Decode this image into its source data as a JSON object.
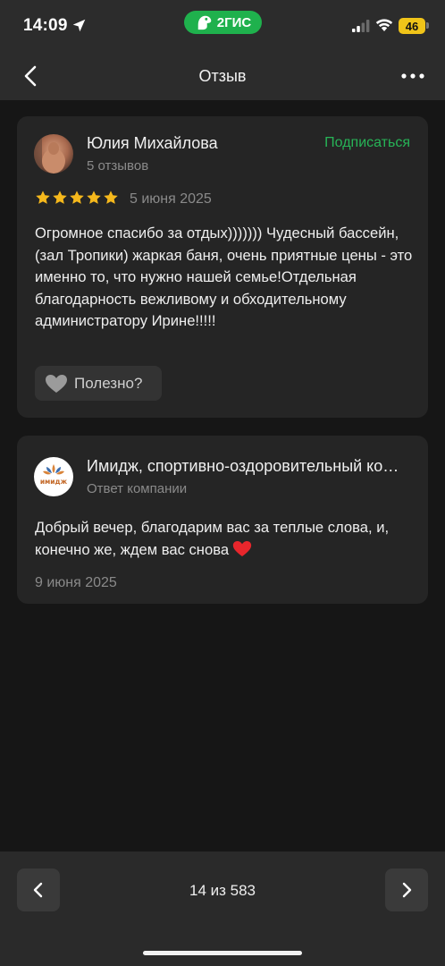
{
  "status_bar": {
    "time": "14:09",
    "app_badge": "2ГИС",
    "battery": "46",
    "colors": {
      "app_badge": "#1fb14d",
      "battery": "#f0c419"
    }
  },
  "nav": {
    "title": "Отзыв",
    "back_icon": "chevron-left-icon",
    "more_icon": "more-horizontal-icon"
  },
  "review": {
    "author": "Юлия Михайлова",
    "author_reviews": "5 отзывов",
    "subscribe_label": "Подписаться",
    "rating": 5,
    "rating_max": 5,
    "date": "5 июня 2025",
    "text": "Огромное спасибо за отдых))))))) Чудесный бассейн,(зал Тропики) жаркая баня, очень приятные цены - это именно то, что нужно нашей семье!Отдельная благодарность вежливому и обходительному администратору Ирине!!!!!",
    "helpful_label": "Полезно?",
    "colors": {
      "subscribe": "#27b457",
      "star": "#f5b81c"
    }
  },
  "reply": {
    "company": "Имидж, спортивно-оздоровительный комплекс",
    "logo_text": "имидж",
    "subtitle": "Ответ компании",
    "text": "Добрый вечер, благодарим вас за теплые слова, и, конечно же, ждем вас снова",
    "date": "9 июня 2025"
  },
  "pager": {
    "label": "14 из 583",
    "current": 14,
    "total": 583
  }
}
